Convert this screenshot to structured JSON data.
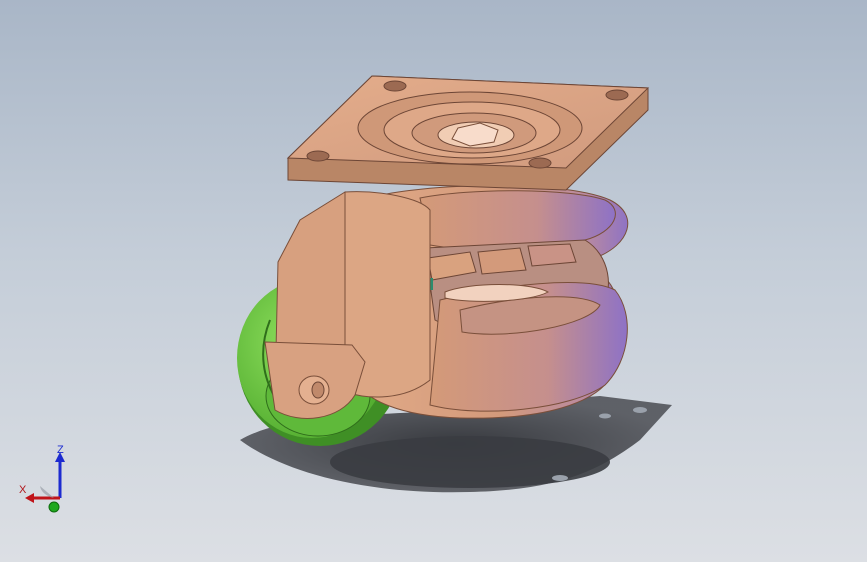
{
  "viewport": {
    "background_top": "#a9b6c7",
    "background_bottom": "#dcdfe4"
  },
  "model": {
    "body_color": "#d9a27f",
    "body_shadow": "#a8735a",
    "body_highlight": "#f0c4a4",
    "purple_tint": "#9a78c6",
    "wheel_color": "#6cc63c",
    "wheel_dark": "#3d8a22",
    "shadow_color": "#3f4147"
  },
  "triad": {
    "x_label": "X",
    "z_label": "Z",
    "x_color": "#c0141a",
    "y_color": "#1fa81f",
    "z_color": "#1d2bd0"
  }
}
